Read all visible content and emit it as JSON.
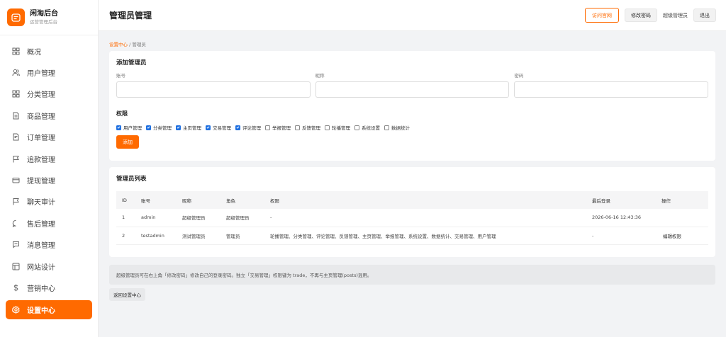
{
  "brand": {
    "title": "闲淘后台",
    "subtitle": "运营管理后台"
  },
  "sidebar": {
    "items": [
      {
        "label": "概况",
        "icon": "grid-icon"
      },
      {
        "label": "用户管理",
        "icon": "user-icon"
      },
      {
        "label": "分类管理",
        "icon": "category-icon"
      },
      {
        "label": "商品管理",
        "icon": "document-icon"
      },
      {
        "label": "订单管理",
        "icon": "order-icon"
      },
      {
        "label": "追款管理",
        "icon": "flag-icon"
      },
      {
        "label": "提现管理",
        "icon": "card-icon"
      },
      {
        "label": "聊天审计",
        "icon": "flag-icon"
      },
      {
        "label": "售后管理",
        "icon": "chat-bubble-icon"
      },
      {
        "label": "消息管理",
        "icon": "message-icon"
      },
      {
        "label": "网站设计",
        "icon": "layout-icon"
      },
      {
        "label": "营销中心",
        "icon": "dollar-icon"
      },
      {
        "label": "设置中心",
        "icon": "gear-icon",
        "active": true
      }
    ]
  },
  "header": {
    "title": "管理员管理",
    "visit_label": "访问官网",
    "change_pw_label": "修改密码",
    "role_label": "超级管理员",
    "logout_label": "退出"
  },
  "breadcrumb": {
    "parent": "设置中心",
    "sep": "/",
    "current": "管理员"
  },
  "add_form": {
    "title": "添加管理员",
    "fields": [
      {
        "label": "账号",
        "value": ""
      },
      {
        "label": "昵称",
        "value": ""
      },
      {
        "label": "密码",
        "value": ""
      }
    ],
    "perm_title": "权限",
    "permissions": [
      {
        "label": "用户管理",
        "checked": true
      },
      {
        "label": "分类管理",
        "checked": true
      },
      {
        "label": "主页管理",
        "checked": true
      },
      {
        "label": "交易管理",
        "checked": true
      },
      {
        "label": "评论管理",
        "checked": true
      },
      {
        "label": "举报管理",
        "checked": false
      },
      {
        "label": "反馈管理",
        "checked": false
      },
      {
        "label": "轮播管理",
        "checked": false
      },
      {
        "label": "系统设置",
        "checked": false
      },
      {
        "label": "数据统计",
        "checked": false
      }
    ],
    "add_label": "添加"
  },
  "list": {
    "title": "管理员列表",
    "columns": [
      "ID",
      "账号",
      "昵称",
      "角色",
      "权限",
      "最后登录",
      "操作"
    ],
    "rows": [
      {
        "id": "1",
        "account": "admin",
        "nickname": "超级管理员",
        "role": "超级管理员",
        "perms": "-",
        "last_login": "2026-06-16 12:43:36",
        "action": ""
      },
      {
        "id": "2",
        "account": "testadmin",
        "nickname": "测试管理员",
        "role": "管理员",
        "perms": "轮播管理、分类管理、评论管理、反馈管理、主页管理、举报管理、系统设置、数据统计、交易管理、用户管理",
        "last_login": "-",
        "action": "编辑权限"
      }
    ]
  },
  "note": "超级管理员可在右上角「修改密码」修改自己的登录密码。独立「交易管理」权限键为 trade，不再与主页管理(posts)混用。",
  "back_label": "返回设置中心",
  "colors": {
    "accent": "#ff6a00",
    "checkbox": "#1e6fe0"
  }
}
